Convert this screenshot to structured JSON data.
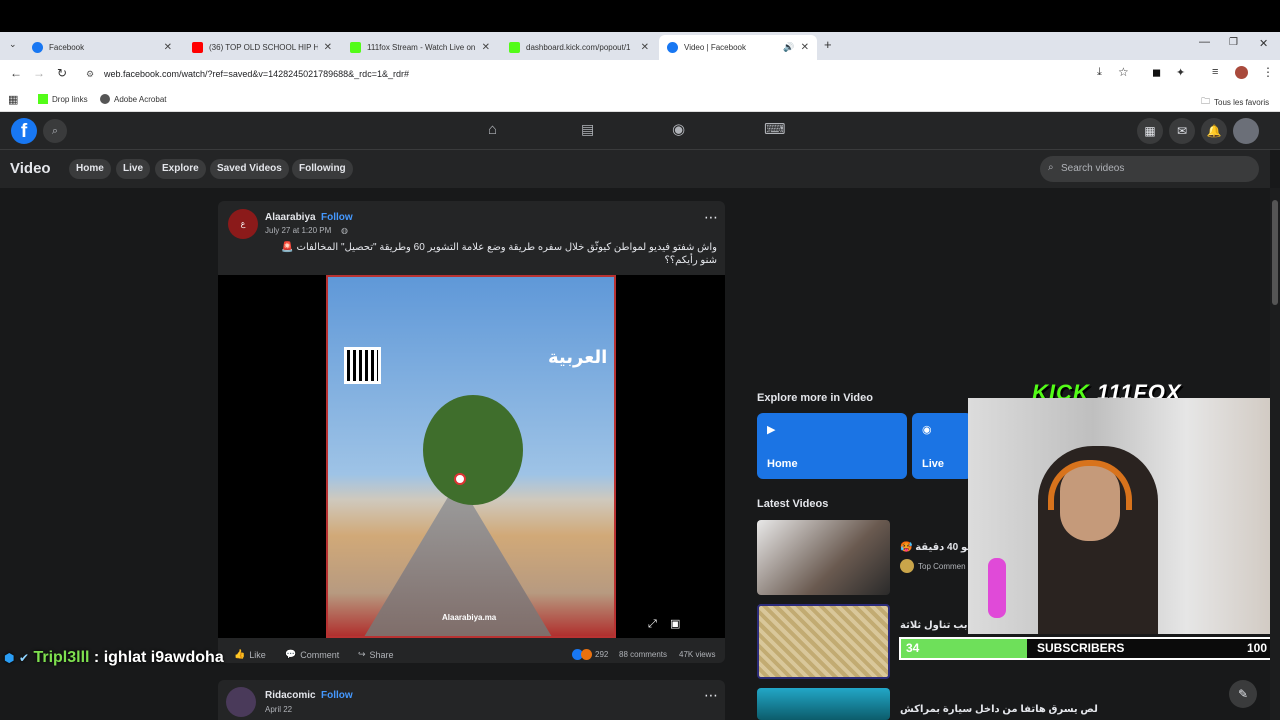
{
  "browser": {
    "tabs": [
      {
        "title": "Facebook",
        "color": "#1877f2"
      },
      {
        "title": "(36) TOP OLD SCHOOL HIP HO",
        "color": "#ff0000"
      },
      {
        "title": "111fox Stream - Watch Live on",
        "color": "#53fc18"
      },
      {
        "title": "dashboard.kick.com/popout/1",
        "color": "#53fc18"
      },
      {
        "title": "Video | Facebook",
        "color": "#1877f2"
      }
    ],
    "url": "web.facebook.com/watch/?ref=saved&v=1428245021789688&_rdc=1&_rdr#",
    "bookmarks": [
      "Drop links",
      "Adobe Acrobat"
    ],
    "all_bookmarks": "Tous les favoris"
  },
  "fb": {
    "section_title": "Video",
    "nav": [
      "Home",
      "Live",
      "Explore",
      "Saved Videos",
      "Following"
    ],
    "search_placeholder": "Search videos"
  },
  "post": {
    "author": "Alaarabiya",
    "follow": "Follow",
    "time": "July 27 at 1:20 PM",
    "text_line1": "واش شفتو فيديو لمواطن كيوثّق خلال سفره طريقة وضع علامة التشوير 60 وطريقة \"تحصيل\" المخالفات 🚨",
    "text_line2": "شنو رأيكم؟؟",
    "video_brand": "العربية",
    "video_handle": "Alaarabiya.ma",
    "like": "Like",
    "comment": "Comment",
    "share": "Share",
    "reactions": "292",
    "comments": "88 comments",
    "views": "47K views"
  },
  "post2": {
    "author": "Ridacomic",
    "follow": "Follow",
    "time": "April 22"
  },
  "sidebar": {
    "explore_title": "Explore more in Video",
    "explore_cards": [
      "Home",
      "Live"
    ],
    "latest_title": "Latest Videos",
    "videos": [
      {
        "title": "🥵 صو 40 دقيقة",
        "sub": "Top Commen"
      },
      {
        "title": "بب تناول ثلاثة",
        "sub": ""
      },
      {
        "title": "لص يسرق هاتفا من داخل سيارة بمراكش",
        "sub": ""
      }
    ]
  },
  "overlay": {
    "kick_label": "KICK",
    "kick_channel": "111FOX",
    "chat_user": "Tripl3lll",
    "chat_message": ": ighlat i9awdoha",
    "subs_current": "34",
    "subs_label": "SUBSCRIBERS",
    "subs_goal": "100",
    "subs_progress": 0.34
  }
}
